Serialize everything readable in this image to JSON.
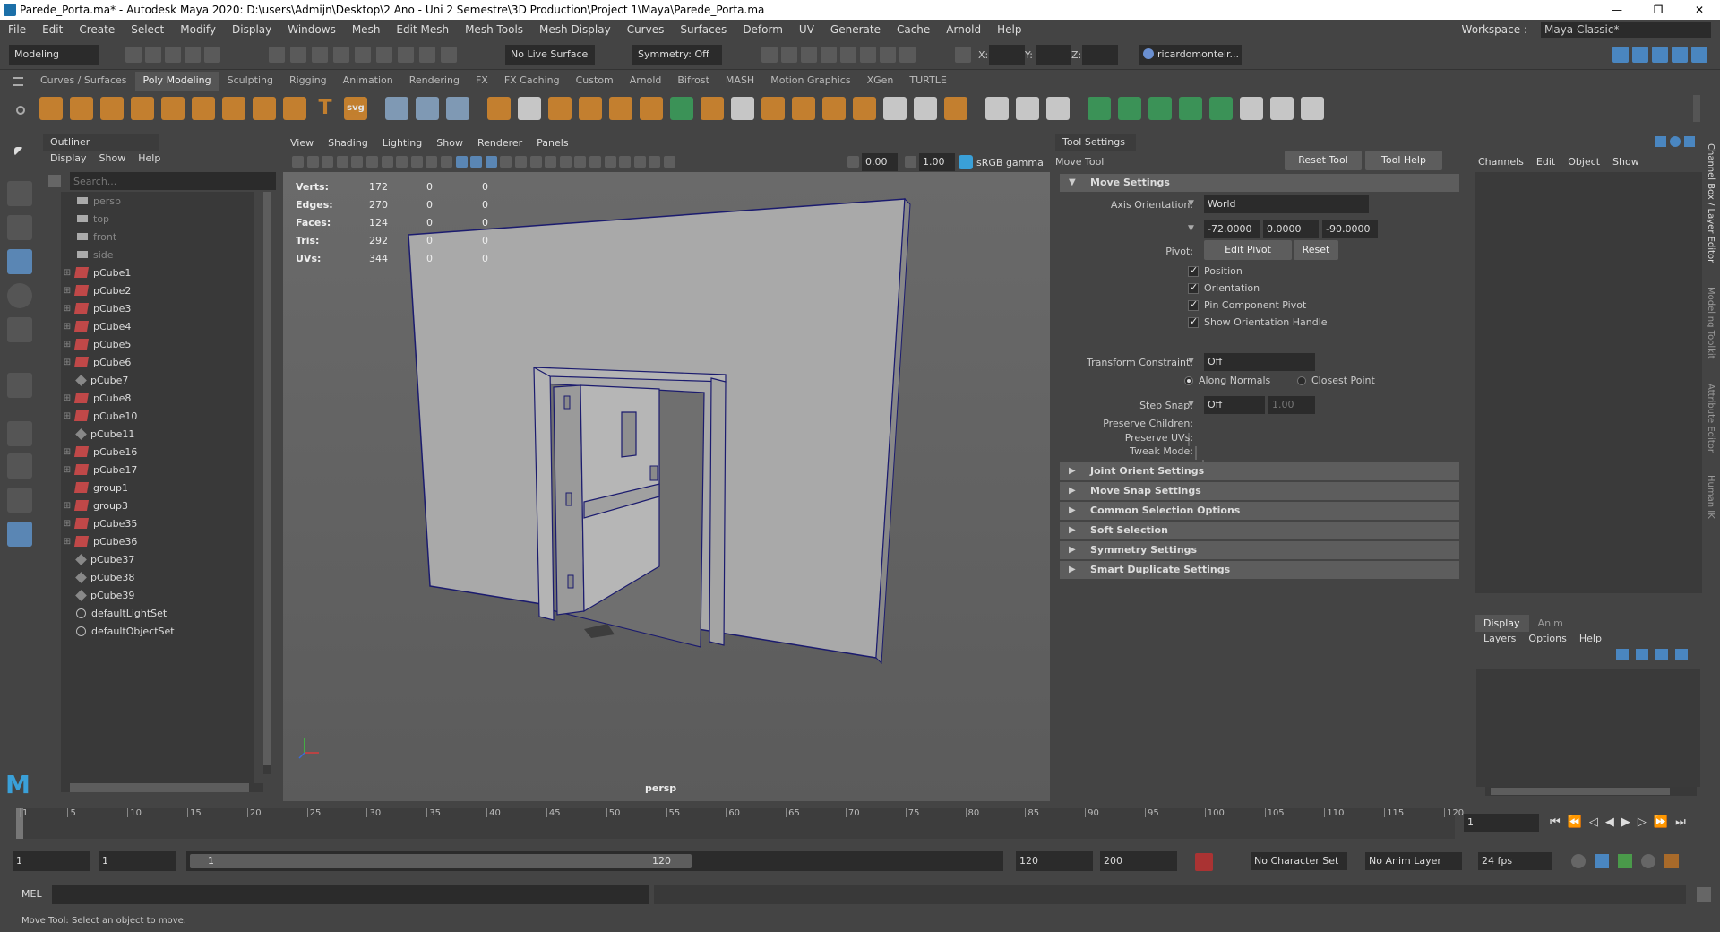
{
  "window": {
    "title": "Parede_Porta.ma* - Autodesk Maya 2020: D:\\users\\Admijn\\Desktop\\2 Ano - Uni 2 Semestre\\3D Production\\Project 1\\Maya\\Parede_Porta.ma",
    "minimize": "—",
    "maximize": "❐",
    "close": "✕"
  },
  "menu": [
    "File",
    "Edit",
    "Create",
    "Select",
    "Modify",
    "Display",
    "Windows",
    "Mesh",
    "Edit Mesh",
    "Mesh Tools",
    "Mesh Display",
    "Curves",
    "Surfaces",
    "Deform",
    "UV",
    "Generate",
    "Cache",
    "Arnold",
    "Help"
  ],
  "workspace": {
    "label": "Workspace :",
    "value": "Maya Classic*"
  },
  "status": {
    "mode": "Modeling",
    "live_surface": "No Live Surface",
    "symmetry": "Symmetry: Off",
    "x_label": "X:",
    "y_label": "Y:",
    "z_label": "Z:",
    "user": "ricardomonteir..."
  },
  "shelf_tabs": [
    "Curves / Surfaces",
    "Poly Modeling",
    "Sculpting",
    "Rigging",
    "Animation",
    "Rendering",
    "FX",
    "FX Caching",
    "Custom",
    "Arnold",
    "Bifrost",
    "MASH",
    "Motion Graphics",
    "XGen",
    "TURTLE"
  ],
  "shelf_svg_label": "svg",
  "shelf_text_label": "T",
  "outliner": {
    "title": "Outliner",
    "menu": [
      "Display",
      "Show",
      "Help"
    ],
    "search_placeholder": "Search...",
    "items": [
      {
        "name": "persp",
        "type": "camera",
        "expand": false,
        "dim": true
      },
      {
        "name": "top",
        "type": "camera",
        "expand": false,
        "dim": true
      },
      {
        "name": "front",
        "type": "camera",
        "expand": false,
        "dim": true
      },
      {
        "name": "side",
        "type": "camera",
        "expand": false,
        "dim": true
      },
      {
        "name": "pCube1",
        "type": "mesh",
        "expand": true
      },
      {
        "name": "pCube2",
        "type": "mesh",
        "expand": true
      },
      {
        "name": "pCube3",
        "type": "mesh",
        "expand": true
      },
      {
        "name": "pCube4",
        "type": "mesh",
        "expand": true
      },
      {
        "name": "pCube5",
        "type": "mesh",
        "expand": true
      },
      {
        "name": "pCube6",
        "type": "mesh",
        "expand": true
      },
      {
        "name": "pCube7",
        "type": "group",
        "expand": false
      },
      {
        "name": "pCube8",
        "type": "mesh",
        "expand": true
      },
      {
        "name": "pCube10",
        "type": "mesh",
        "expand": true
      },
      {
        "name": "pCube11",
        "type": "group",
        "expand": false
      },
      {
        "name": "pCube16",
        "type": "mesh",
        "expand": true
      },
      {
        "name": "pCube17",
        "type": "mesh",
        "expand": true
      },
      {
        "name": "group1",
        "type": "mesh",
        "expand": false
      },
      {
        "name": "group3",
        "type": "mesh",
        "expand": true
      },
      {
        "name": "pCube35",
        "type": "mesh",
        "expand": true
      },
      {
        "name": "pCube36",
        "type": "mesh",
        "expand": true
      },
      {
        "name": "pCube37",
        "type": "group",
        "expand": false
      },
      {
        "name": "pCube38",
        "type": "group",
        "expand": false
      },
      {
        "name": "pCube39",
        "type": "group",
        "expand": false
      },
      {
        "name": "defaultLightSet",
        "type": "set",
        "expand": false
      },
      {
        "name": "defaultObjectSet",
        "type": "set",
        "expand": false
      }
    ]
  },
  "viewport": {
    "menu": [
      "View",
      "Shading",
      "Lighting",
      "Show",
      "Renderer",
      "Panels"
    ],
    "field1": "0.00",
    "field2": "1.00",
    "color_space": "sRGB gamma",
    "camera": "persp",
    "hud": [
      {
        "label": "Verts:",
        "a": "172",
        "b": "0",
        "c": "0"
      },
      {
        "label": "Edges:",
        "a": "270",
        "b": "0",
        "c": "0"
      },
      {
        "label": "Faces:",
        "a": "124",
        "b": "0",
        "c": "0"
      },
      {
        "label": "Tris:",
        "a": "292",
        "b": "0",
        "c": "0"
      },
      {
        "label": "UVs:",
        "a": "344",
        "b": "0",
        "c": "0"
      }
    ]
  },
  "tool_settings": {
    "title": "Tool Settings",
    "tool": "Move Tool",
    "reset_tool": "Reset Tool",
    "tool_help": "Tool Help",
    "move_settings": "Move Settings",
    "axis_orientation_label": "Axis Orientation:",
    "axis_orientation": "World",
    "rot": [
      "-72.0000",
      "0.0000",
      "-90.0000"
    ],
    "pivot_label": "Pivot:",
    "edit_pivot": "Edit Pivot",
    "reset": "Reset",
    "checks": [
      "Position",
      "Orientation",
      "Pin Component Pivot",
      "Show Orientation Handle"
    ],
    "transform_constraint_label": "Transform Constraint:",
    "transform_constraint": "Off",
    "along_normals": "Along Normals",
    "closest_point": "Closest Point",
    "step_snap_label": "Step Snap:",
    "step_snap": "Off",
    "step_value": "1.00",
    "preserve_children": "Preserve Children:",
    "preserve_uvs": "Preserve UVs:",
    "tweak_mode": "Tweak Mode:",
    "frames": [
      "Joint Orient Settings",
      "Move Snap Settings",
      "Common Selection Options",
      "Soft Selection",
      "Symmetry Settings",
      "Smart Duplicate Settings"
    ]
  },
  "channel_box": {
    "menu": [
      "Channels",
      "Edit",
      "Object",
      "Show"
    ],
    "tabs": [
      "Display",
      "Anim"
    ],
    "layer_menu": [
      "Layers",
      "Options",
      "Help"
    ]
  },
  "side_tabs": [
    "Channel Box / Layer Editor",
    "Modeling Toolkit",
    "Attribute Editor",
    "Human IK"
  ],
  "timeline": {
    "ticks": [
      "1",
      "5",
      "10",
      "15",
      "20",
      "25",
      "30",
      "35",
      "40",
      "45",
      "50",
      "55",
      "60",
      "65",
      "70",
      "75",
      "80",
      "85",
      "90",
      "95",
      "100",
      "105",
      "110",
      "115",
      "120"
    ],
    "current": "1"
  },
  "range": {
    "start": "1",
    "start2": "1",
    "slider_start": "1",
    "slider_end": "120",
    "end": "120",
    "end2": "200",
    "char_set": "No Character Set",
    "anim_layer": "No Anim Layer",
    "fps": "24 fps"
  },
  "cmd": {
    "label": "MEL"
  },
  "help_line": "Move Tool: Select an object to move."
}
